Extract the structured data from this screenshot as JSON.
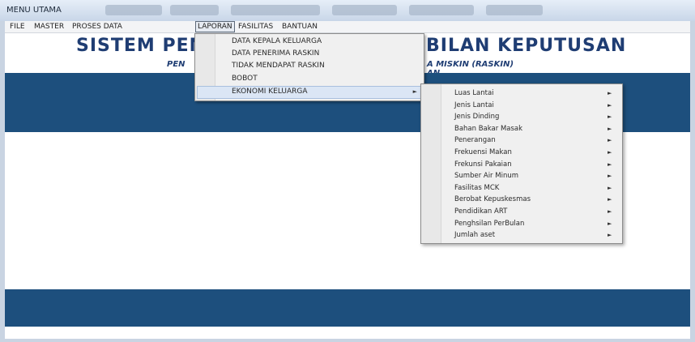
{
  "window": {
    "title": "MENU UTAMA"
  },
  "menubar": [
    {
      "label": "FILE"
    },
    {
      "label": "MASTER"
    },
    {
      "label": "PROSES DATA"
    },
    {
      "label": "LAPORAN"
    },
    {
      "label": "FASILITAS"
    },
    {
      "label": "BANTUAN"
    }
  ],
  "header": {
    "title_left": "SISTEM PEN",
    "title_right": "BILAN KEPUTUSAN",
    "subtitle_left": "PEN",
    "subtitle_right": "A MISKIN (RASKIN)",
    "subtitle2_right": "AN"
  },
  "laporan_menu": [
    {
      "label": "DATA KEPALA KELUARGA"
    },
    {
      "label": "DATA PENERIMA RASKIN"
    },
    {
      "label": "TIDAK MENDAPAT RASKIN"
    },
    {
      "label": "BOBOT"
    },
    {
      "label": "EKONOMI KELUARGA",
      "arrow": "►"
    }
  ],
  "ekonomi_submenu": [
    {
      "label": "Luas Lantai",
      "arrow": "►"
    },
    {
      "label": "Jenis Lantai",
      "arrow": "►"
    },
    {
      "label": "Jenis Dinding",
      "arrow": "►"
    },
    {
      "label": "Bahan Bakar Masak",
      "arrow": "►"
    },
    {
      "label": "Penerangan",
      "arrow": "►"
    },
    {
      "label": "Frekuensi Makan",
      "arrow": "►"
    },
    {
      "label": "Frekunsi Pakaian",
      "arrow": "►"
    },
    {
      "label": "Sumber Air Minum",
      "arrow": "►"
    },
    {
      "label": "Fasilitas MCK",
      "arrow": "►"
    },
    {
      "label": "Berobat Kepuskesmas",
      "arrow": "►"
    },
    {
      "label": "Pendidikan ART",
      "arrow": "►"
    },
    {
      "label": "Penghsilan PerBulan",
      "arrow": "►"
    },
    {
      "label": "Jumlah aset",
      "arrow": "►"
    }
  ],
  "colors": {
    "heading": "#1f3d73",
    "band": "#1d4f7d",
    "menu_bg": "#f0f0f0"
  }
}
